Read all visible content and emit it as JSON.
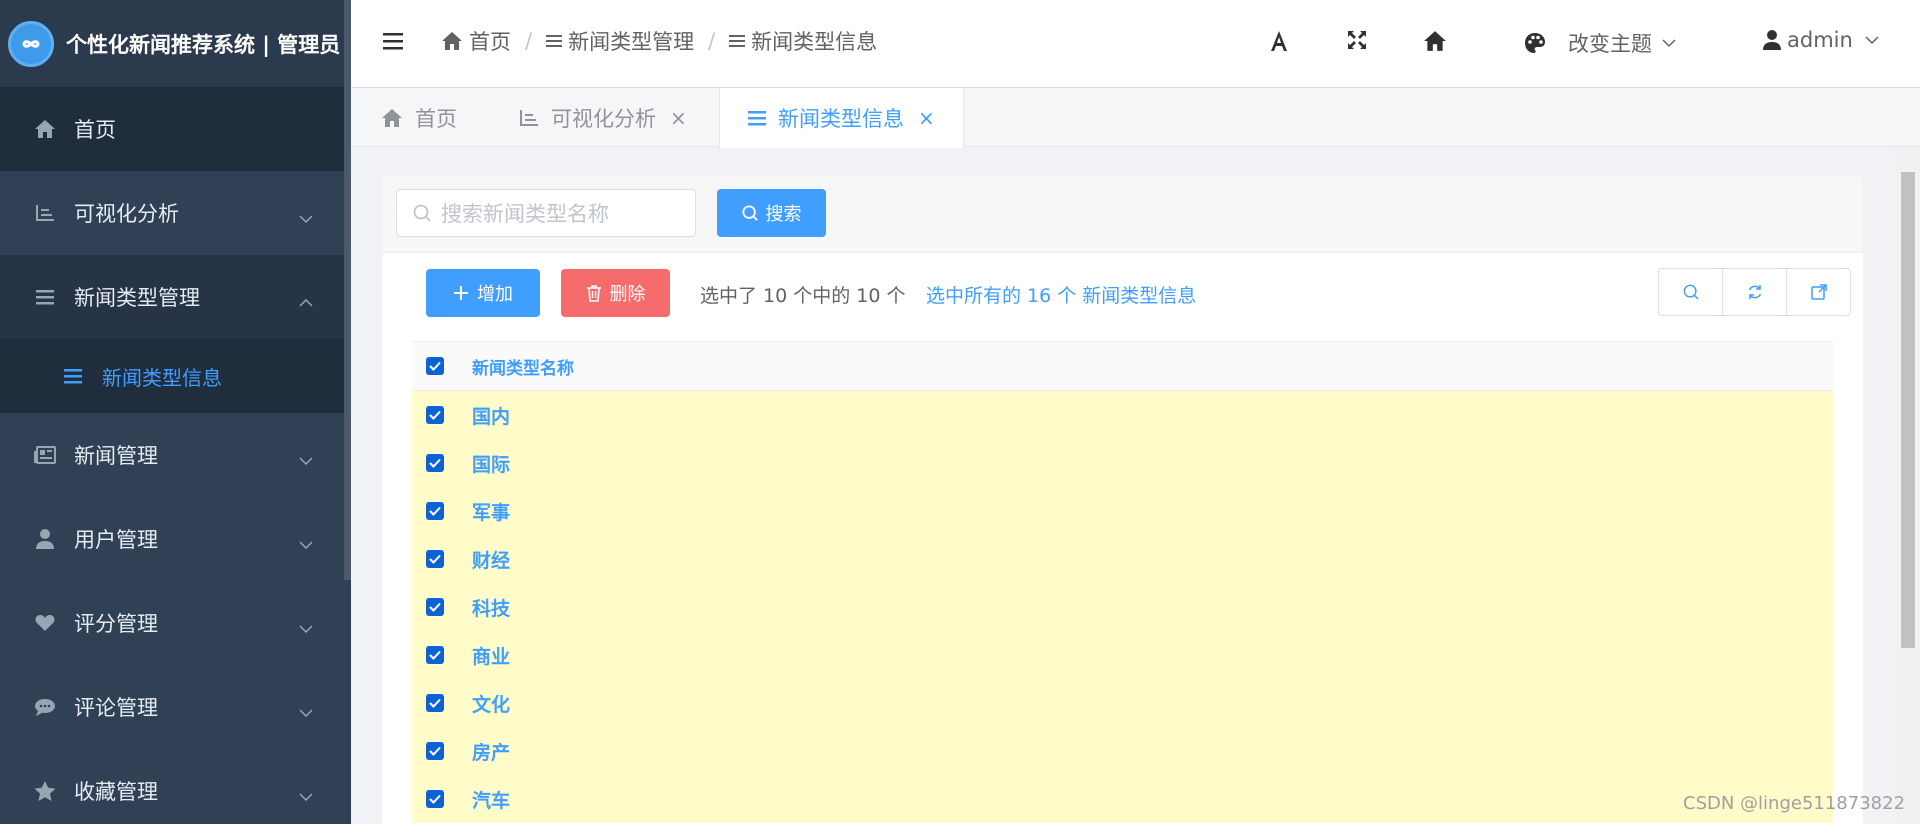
{
  "app": {
    "title": "个性化新闻推荐系统 | 管理员"
  },
  "sidebar": {
    "items": [
      {
        "label": "首页"
      },
      {
        "label": "可视化分析"
      },
      {
        "label": "新闻类型管理"
      },
      {
        "label": "新闻类型信息"
      },
      {
        "label": "新闻管理"
      },
      {
        "label": "用户管理"
      },
      {
        "label": "评分管理"
      },
      {
        "label": "评论管理"
      },
      {
        "label": "收藏管理"
      }
    ]
  },
  "header": {
    "breadcrumbs": [
      "首页",
      "新闻类型管理",
      "新闻类型信息"
    ],
    "separator": "/",
    "theme_label": "改变主题",
    "user_label": "admin"
  },
  "tabs": [
    {
      "label": "首页"
    },
    {
      "label": "可视化分析",
      "close": "×"
    },
    {
      "label": "新闻类型信息",
      "close": "×"
    }
  ],
  "search": {
    "placeholder": "搜索新闻类型名称",
    "button_label": "搜索"
  },
  "toolbar": {
    "add_label": "增加",
    "delete_label": "删除",
    "selection_info": "选中了 10 个中的 10 个",
    "select_all_link": "选中所有的 16 个 新闻类型信息"
  },
  "table": {
    "header": "新闻类型名称",
    "rows": [
      "国内",
      "国际",
      "军事",
      "财经",
      "科技",
      "商业",
      "文化",
      "房产",
      "汽车"
    ]
  },
  "watermark": "CSDN @linge511873822",
  "colors": {
    "sidebar": "#304156",
    "accent": "#409eff",
    "danger": "#f56c6c",
    "selected_row": "#fffcc9"
  }
}
